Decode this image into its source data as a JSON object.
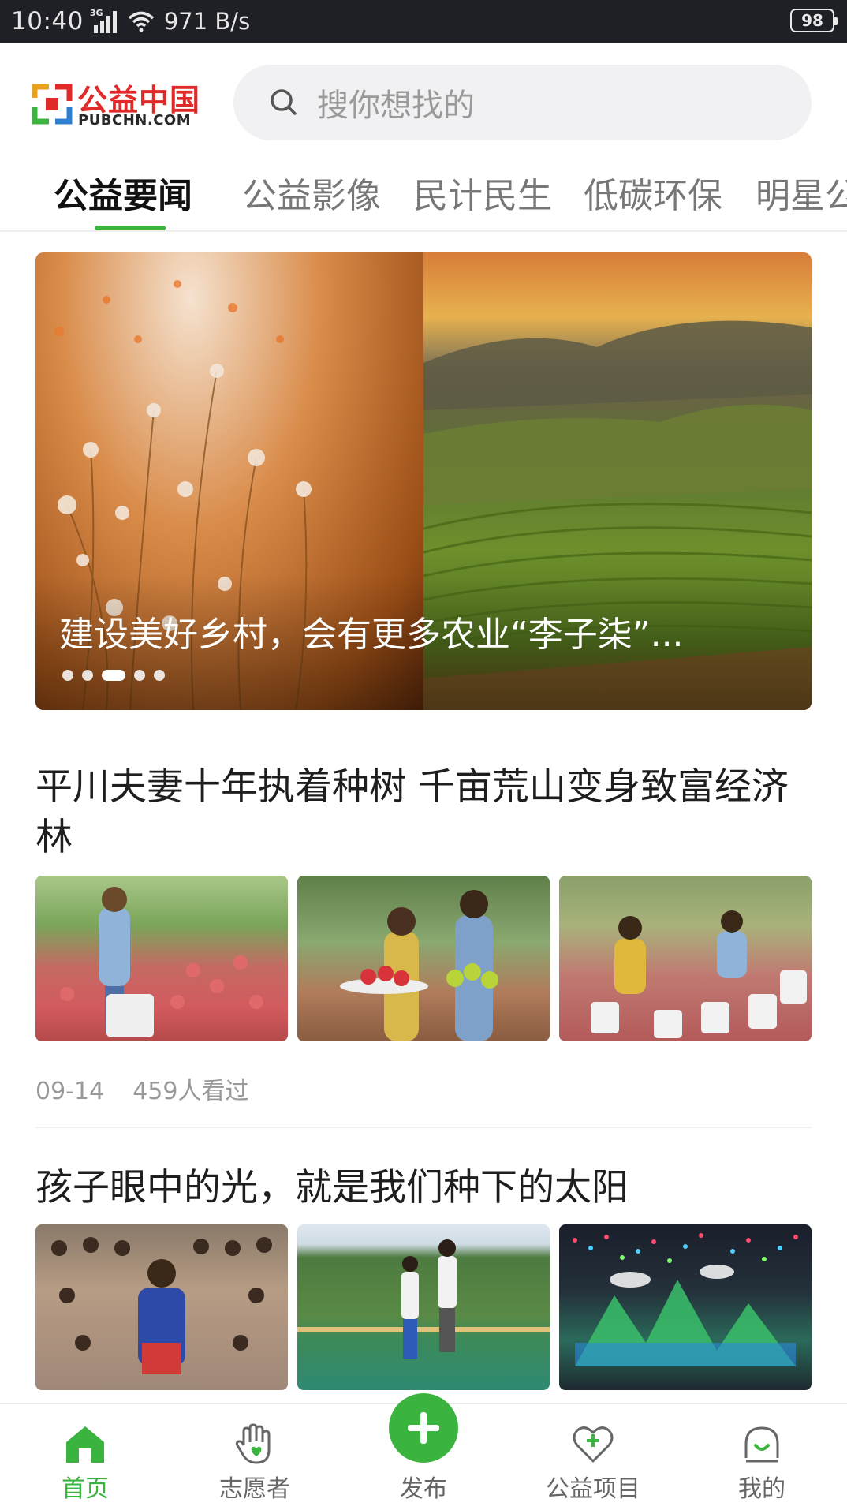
{
  "status_bar": {
    "time": "10:40",
    "network_type": "3G",
    "net_speed": "971 B/s",
    "battery": "98"
  },
  "header": {
    "logo_cn": "公益中国",
    "logo_en": "PUBCHN.COM",
    "search_placeholder": "搜你想找的"
  },
  "tabs": [
    {
      "label": "公益要闻",
      "active": true
    },
    {
      "label": "公益影像",
      "active": false
    },
    {
      "label": "民计民生",
      "active": false
    },
    {
      "label": "低碳环保",
      "active": false
    },
    {
      "label": "明星公益",
      "active": false
    }
  ],
  "banner": {
    "title": "建设美好乡村，会有更多农业“李子柒”...",
    "dot_count": 5,
    "active_dot": 3
  },
  "articles": [
    {
      "title": "平川夫妻十年执着种树 千亩荒山变身致富经济林",
      "date": "09-14",
      "views": "459人看过",
      "images": [
        "peach-harvest-photo",
        "couple-holding-fruit-photo",
        "fruit-buckets-photo"
      ]
    },
    {
      "title": "孩子眼中的光，就是我们种下的太阳",
      "images": [
        "students-group-photo",
        "children-playground-photo",
        "stage-lights-photo"
      ]
    }
  ],
  "bottom_nav": [
    {
      "label": "首页",
      "icon": "home-icon",
      "active": true
    },
    {
      "label": "志愿者",
      "icon": "volunteer-hand-icon",
      "active": false
    },
    {
      "label": "发布",
      "icon": "plus-icon",
      "active": false
    },
    {
      "label": "公益项目",
      "icon": "heart-plus-icon",
      "active": false
    },
    {
      "label": "我的",
      "icon": "profile-smile-icon",
      "active": false
    }
  ],
  "colors": {
    "accent": "#3bb33f",
    "logo_red": "#e02a2a",
    "status_bar_bg": "#1f1f26"
  }
}
